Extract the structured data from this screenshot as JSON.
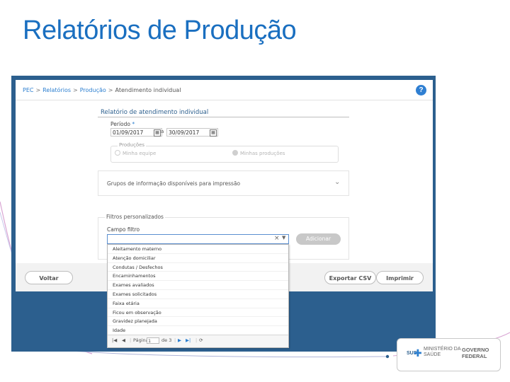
{
  "slide": {
    "title": "Relatórios de Produção"
  },
  "breadcrumb": {
    "root": "PEC",
    "sep": ">",
    "level1": "Relatórios",
    "level2": "Produção",
    "current": "Atendimento individual"
  },
  "help": {
    "label": "?"
  },
  "report": {
    "title": "Relatório de atendimento individual",
    "periodo_label": "Período",
    "periodo_required": "*",
    "date_start": "01/09/2017",
    "range_sep": "a",
    "date_end": "30/09/2017",
    "producoes_label": "Produções",
    "radio_equipe": "Minha equipe",
    "radio_minhas": "Minhas produções"
  },
  "groups": {
    "label": "Grupos de informação disponíveis para impressão"
  },
  "filters": {
    "legend": "Filtros personalizados",
    "campo_label": "Campo filtro",
    "add_label": "Adicionar"
  },
  "dropdown": {
    "items": [
      "Aleitamento materno",
      "Atenção domiciliar",
      "Condutas / Desfechos",
      "Encaminhamentos",
      "Exames avaliados",
      "Exames solicitados",
      "Faixa etária",
      "Ficou em observação",
      "Gravidez planejada",
      "Idade"
    ],
    "page_label": "Página",
    "page_value": "1",
    "page_of": "de 3"
  },
  "actions": {
    "voltar": "Voltar",
    "exportar": "Exportar CSV",
    "imprimir": "Imprimir"
  },
  "logos": {
    "sus": "SUS",
    "ministerio_line1": "MINISTÉRIO DA",
    "ministerio_line2": "SAÚDE",
    "governo_line1": "GOVERNO",
    "governo_line2": "FEDERAL"
  }
}
